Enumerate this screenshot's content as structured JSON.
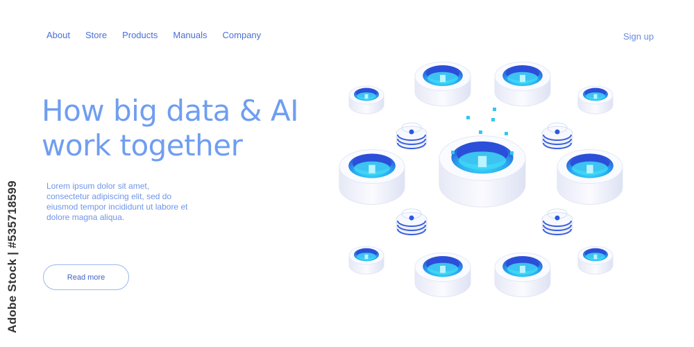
{
  "nav": {
    "items": [
      "About",
      "Store",
      "Products",
      "Manuals",
      "Company"
    ],
    "signup": "Sign up"
  },
  "hero": {
    "title_line1": "How big data & AI",
    "title_line2": "work together",
    "body": "Lorem ipsum dolor sit amet, consectetur adipiscing elit, sed do eiusmod tempor incididunt ut labore et dolore magna aliqua.",
    "button": "Read more"
  },
  "watermark": "Adobe Stock | #535718599",
  "colors": {
    "accent": "#4a6fd6",
    "title": "#6f9ef0",
    "cylinder_blue": "#2f5fe0",
    "glow": "#39d5f5"
  }
}
